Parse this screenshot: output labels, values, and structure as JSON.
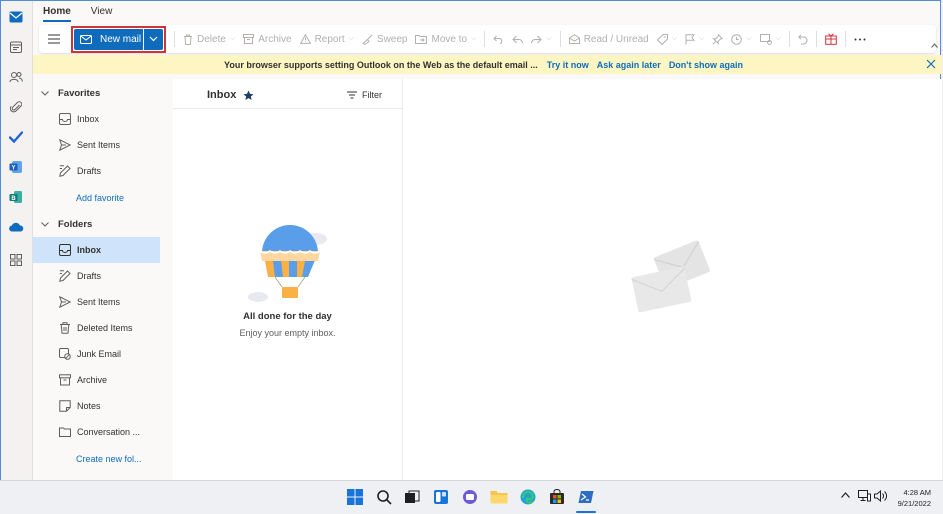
{
  "tabs": [
    {
      "label": "Home"
    },
    {
      "label": "View"
    }
  ],
  "ribbon": {
    "new_mail": "New mail",
    "delete": "Delete",
    "archive": "Archive",
    "report": "Report",
    "sweep": "Sweep",
    "move_to": "Move to",
    "read_unread": "Read / Unread"
  },
  "infobar": {
    "message": "Your browser supports setting Outlook on the Web as the default email ...",
    "try_it": "Try it now",
    "ask_later": "Ask again later",
    "dont_show": "Don't show again"
  },
  "folders": {
    "favorites_header": "Favorites",
    "favorites": [
      {
        "label": "Inbox"
      },
      {
        "label": "Sent Items"
      },
      {
        "label": "Drafts"
      }
    ],
    "add_favorite": "Add favorite",
    "folders_header": "Folders",
    "items": [
      {
        "label": "Inbox"
      },
      {
        "label": "Drafts"
      },
      {
        "label": "Sent Items"
      },
      {
        "label": "Deleted Items"
      },
      {
        "label": "Junk Email"
      },
      {
        "label": "Archive"
      },
      {
        "label": "Notes"
      },
      {
        "label": "Conversation ..."
      }
    ],
    "create_new": "Create new fol..."
  },
  "message_list": {
    "title": "Inbox",
    "filter": "Filter",
    "empty_title": "All done for the day",
    "empty_subtitle": "Enjoy your empty inbox."
  },
  "taskbar": {
    "time": "4:28 AM",
    "date": "9/21/2022"
  },
  "colors": {
    "accent": "#0f6cbd",
    "highlight_border": "#d13438",
    "infobar": "#fdf6c3",
    "selected": "#cfe4fa"
  }
}
